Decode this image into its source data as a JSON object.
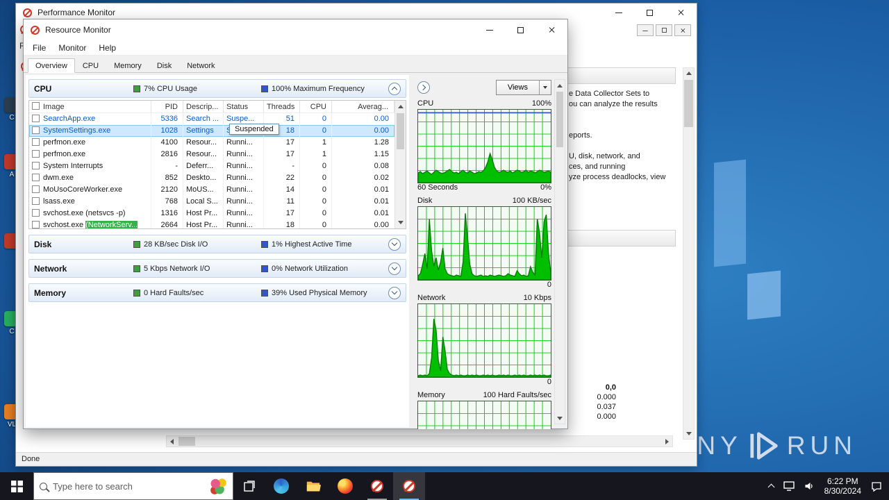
{
  "desktop": {
    "icons": [
      {
        "label": "C",
        "color": "#2c3e50"
      },
      {
        "label": "A",
        "color": "#c0392b"
      },
      {
        "label": "",
        "color": "#c0392b"
      },
      {
        "label": "C",
        "color": "#27ae60"
      },
      {
        "label": "VL",
        "color": "#e67e22"
      }
    ],
    "watermark_left": "ANY",
    "watermark_right": "RUN"
  },
  "perfmon": {
    "title": "Performance Monitor",
    "fragment_text": "Re",
    "help_lines": [
      "e Data Collector Sets to",
      "ou can analyze the results",
      "eports.",
      "U, disk, network, and",
      "ces, and running",
      "yze process deadlocks, view"
    ],
    "report_values": [
      "0,0",
      "0.000",
      "0.037",
      "0.000"
    ],
    "status": "Done"
  },
  "resmon": {
    "title": "Resource Monitor",
    "menus": [
      "File",
      "Monitor",
      "Help"
    ],
    "tabs": [
      "Overview",
      "CPU",
      "Memory",
      "Disk",
      "Network"
    ],
    "active_tab": "Overview",
    "sections": {
      "cpu": {
        "title": "CPU",
        "green_stat": "7% CPU Usage",
        "blue_stat": "100% Maximum Frequency"
      },
      "disk": {
        "title": "Disk",
        "green_stat": "28 KB/sec Disk I/O",
        "blue_stat": "1% Highest Active Time"
      },
      "network": {
        "title": "Network",
        "green_stat": "5 Kbps Network I/O",
        "blue_stat": "0% Network Utilization"
      },
      "memory": {
        "title": "Memory",
        "green_stat": "0 Hard Faults/sec",
        "blue_stat": "39% Used Physical Memory"
      }
    },
    "process_table": {
      "columns": [
        "Image",
        "PID",
        "Descrip...",
        "Status",
        "Threads",
        "CPU",
        "Averag..."
      ],
      "rows": [
        {
          "image": "SearchApp.exe",
          "pid": "5336",
          "desc": "Search ...",
          "status": "Suspe...",
          "threads": "51",
          "cpu": "0",
          "avg": "0.00",
          "state": "suspended"
        },
        {
          "image": "SystemSettings.exe",
          "pid": "1028",
          "desc": "Settings",
          "status": "Suspe...",
          "threads": "18",
          "cpu": "0",
          "avg": "0.00",
          "state": "selected suspended",
          "tooltip": "Suspended"
        },
        {
          "image": "perfmon.exe",
          "pid": "4100",
          "desc": "Resour...",
          "status": "Runni...",
          "threads": "17",
          "cpu": "1",
          "avg": "1.28",
          "state": ""
        },
        {
          "image": "perfmon.exe",
          "pid": "2816",
          "desc": "Resour...",
          "status": "Runni...",
          "threads": "17",
          "cpu": "1",
          "avg": "1.15",
          "state": ""
        },
        {
          "image": "System Interrupts",
          "pid": "-",
          "desc": "Deferr...",
          "status": "Runni...",
          "threads": "-",
          "cpu": "0",
          "avg": "0.08",
          "state": ""
        },
        {
          "image": "dwm.exe",
          "pid": "852",
          "desc": "Deskto...",
          "status": "Runni...",
          "threads": "22",
          "cpu": "0",
          "avg": "0.02",
          "state": ""
        },
        {
          "image": "MoUsoCoreWorker.exe",
          "pid": "2120",
          "desc": "MoUS...",
          "status": "Runni...",
          "threads": "14",
          "cpu": "0",
          "avg": "0.01",
          "state": ""
        },
        {
          "image": "lsass.exe",
          "pid": "768",
          "desc": "Local S...",
          "status": "Runni...",
          "threads": "11",
          "cpu": "0",
          "avg": "0.01",
          "state": ""
        },
        {
          "image": "svchost.exe (netsvcs -p)",
          "pid": "1316",
          "desc": "Host Pr...",
          "status": "Runni...",
          "threads": "17",
          "cpu": "0",
          "avg": "0.01",
          "state": ""
        },
        {
          "image": "svchost.exe ",
          "image_hl": "(NetworkServ...",
          "pid": "2664",
          "desc": "Host Pr...",
          "status": "Runni...",
          "threads": "18",
          "cpu": "0",
          "avg": "0.00",
          "state": "partial"
        }
      ]
    },
    "views_button": "Views",
    "graphs": {
      "footer_left": "60 Seconds",
      "items": [
        {
          "name": "CPU",
          "scale": "100%",
          "bottom": "0%",
          "values": [
            14,
            16,
            13,
            15,
            17,
            14,
            12,
            15,
            18,
            16,
            14,
            13,
            15,
            17,
            19,
            16,
            14,
            15,
            13,
            16,
            18,
            15,
            14,
            17,
            15,
            13,
            14,
            16,
            15,
            17,
            22,
            30,
            42,
            33,
            22,
            17,
            15,
            16,
            18,
            16,
            15,
            17,
            14,
            16,
            18,
            17,
            15,
            16,
            18,
            15,
            17,
            16,
            14,
            16,
            18,
            17,
            15,
            16,
            17,
            15
          ]
        },
        {
          "name": "Disk",
          "scale": "100 KB/sec",
          "bottom": "0",
          "values": [
            6,
            9,
            22,
            38,
            16,
            88,
            42,
            20,
            32,
            14,
            26,
            46,
            16,
            9,
            7,
            6,
            5,
            7,
            6,
            5,
            26,
            96,
            62,
            22,
            9,
            6,
            5,
            6,
            7,
            5,
            6,
            5,
            7,
            6,
            5,
            6,
            7,
            6,
            5,
            6,
            9,
            7,
            6,
            5,
            13,
            9,
            6,
            7,
            5,
            6,
            19,
            11,
            7,
            88,
            68,
            32,
            84,
            94,
            38,
            10
          ]
        },
        {
          "name": "Network",
          "scale": "10 Kbps",
          "bottom": "0",
          "values": [
            2,
            3,
            2,
            3,
            2,
            5,
            28,
            84,
            68,
            24,
            9,
            58,
            38,
            11,
            5,
            3,
            2,
            3,
            2,
            3,
            2,
            2,
            3,
            2,
            3,
            2,
            3,
            2,
            2,
            3,
            2,
            3,
            2,
            3,
            2,
            2,
            3,
            2,
            3,
            2,
            3,
            2,
            2,
            3,
            2,
            3,
            2,
            3,
            2,
            2,
            3,
            2,
            3,
            2,
            3,
            2,
            3,
            2,
            2,
            3
          ]
        },
        {
          "name": "Memory",
          "scale": "100 Hard Faults/sec",
          "bottom": "",
          "values": [
            3,
            3,
            3,
            3,
            3,
            3,
            3,
            3,
            3,
            3,
            3,
            3,
            3,
            3,
            3,
            3,
            3,
            3,
            3,
            3,
            3,
            3,
            3,
            3,
            3,
            3,
            3,
            3,
            3,
            3,
            3,
            3,
            3,
            3,
            3,
            3,
            3,
            3,
            3,
            3,
            3,
            3,
            3,
            3,
            3,
            3,
            3,
            3,
            3,
            3,
            3,
            3,
            3,
            3,
            3,
            3,
            3,
            3,
            3,
            3
          ]
        }
      ]
    }
  },
  "taskbar": {
    "search_placeholder": "Type here to search",
    "time": "6:22 PM",
    "date": "8/30/2024"
  }
}
